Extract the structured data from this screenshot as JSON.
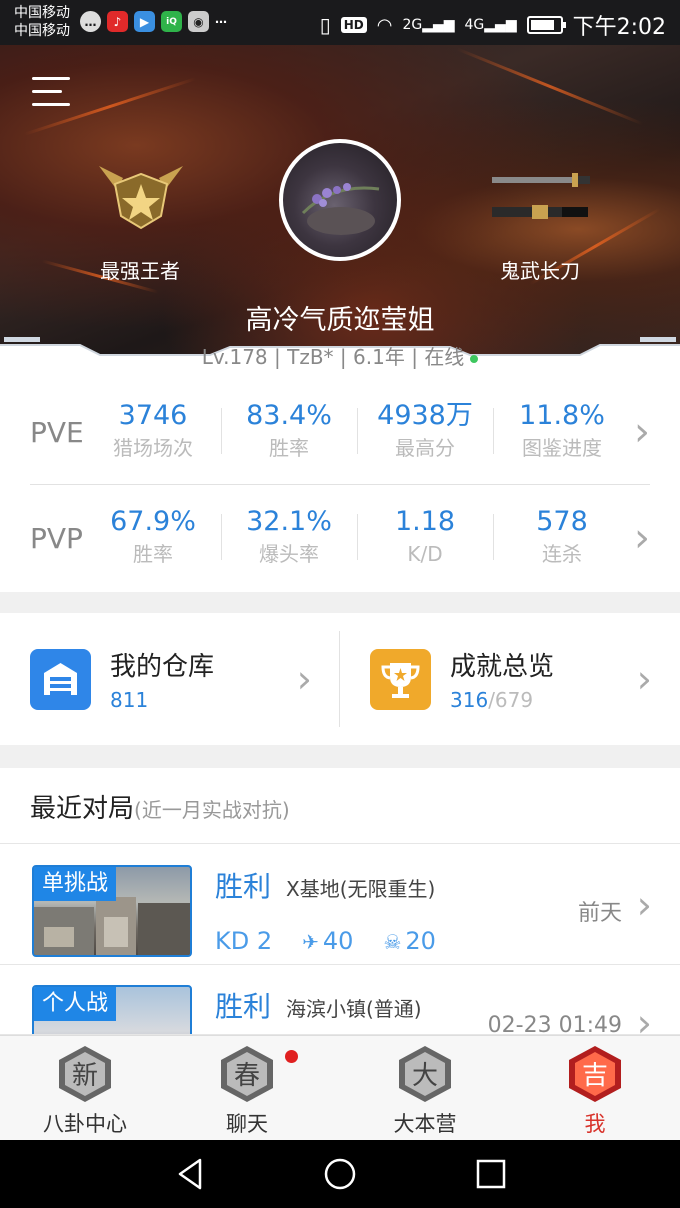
{
  "status_bar": {
    "carrier_1": "中国移动",
    "carrier_2": "中国移动",
    "icons_left": [
      "chat-bubble-icon",
      "netease-music-icon",
      "video-app-icon",
      "iqiyi-icon",
      "app-icon",
      "more-icon"
    ],
    "network_1": "2G",
    "network_2": "4G",
    "hd_label": "HD",
    "time": "下午2:02"
  },
  "hero": {
    "rank_label": "最强王者",
    "weapon_label": "鬼武长刀",
    "player_name": "高冷气质迩莹姐",
    "level": "Lv.178",
    "clan": "TzB*",
    "years": "6.1年",
    "online": "在线",
    "sep": "|"
  },
  "stats": {
    "pve": {
      "label": "PVE",
      "cells": [
        {
          "value": "3746",
          "label": "猎场场次"
        },
        {
          "value": "83.4%",
          "label": "胜率"
        },
        {
          "value": "4938万",
          "label": "最高分"
        },
        {
          "value": "11.8%",
          "label": "图鉴进度"
        }
      ]
    },
    "pvp": {
      "label": "PVP",
      "cells": [
        {
          "value": "67.9%",
          "label": "胜率"
        },
        {
          "value": "32.1%",
          "label": "爆头率"
        },
        {
          "value": "1.18",
          "label": "K/D"
        },
        {
          "value": "578",
          "label": "连杀"
        }
      ]
    }
  },
  "quick": {
    "warehouse": {
      "title": "我的仓库",
      "count": "811"
    },
    "achievements": {
      "title": "成就总览",
      "done": "316",
      "total": "/679"
    }
  },
  "recent": {
    "title": "最近对局",
    "subtitle": "(近一月实战对抗)",
    "matches": [
      {
        "tag": "单挑战",
        "result": "胜利",
        "map": "X基地(无限重生)",
        "time": "前天",
        "kd": "KD 2",
        "kills": "40",
        "headshots": "20"
      },
      {
        "tag": "个人战",
        "result": "胜利",
        "map": "海滨小镇(普通)",
        "time": "02-23 01:49"
      }
    ]
  },
  "bottom_nav": {
    "items": [
      {
        "label": "八卦中心",
        "glyph": "新"
      },
      {
        "label": "聊天",
        "glyph": "春"
      },
      {
        "label": "大本营",
        "glyph": "大"
      },
      {
        "label": "我",
        "glyph": "吉"
      }
    ]
  },
  "colors": {
    "accent_blue": "#2b82d9",
    "active_red": "#d8322a",
    "online_green": "#3ec75f"
  }
}
